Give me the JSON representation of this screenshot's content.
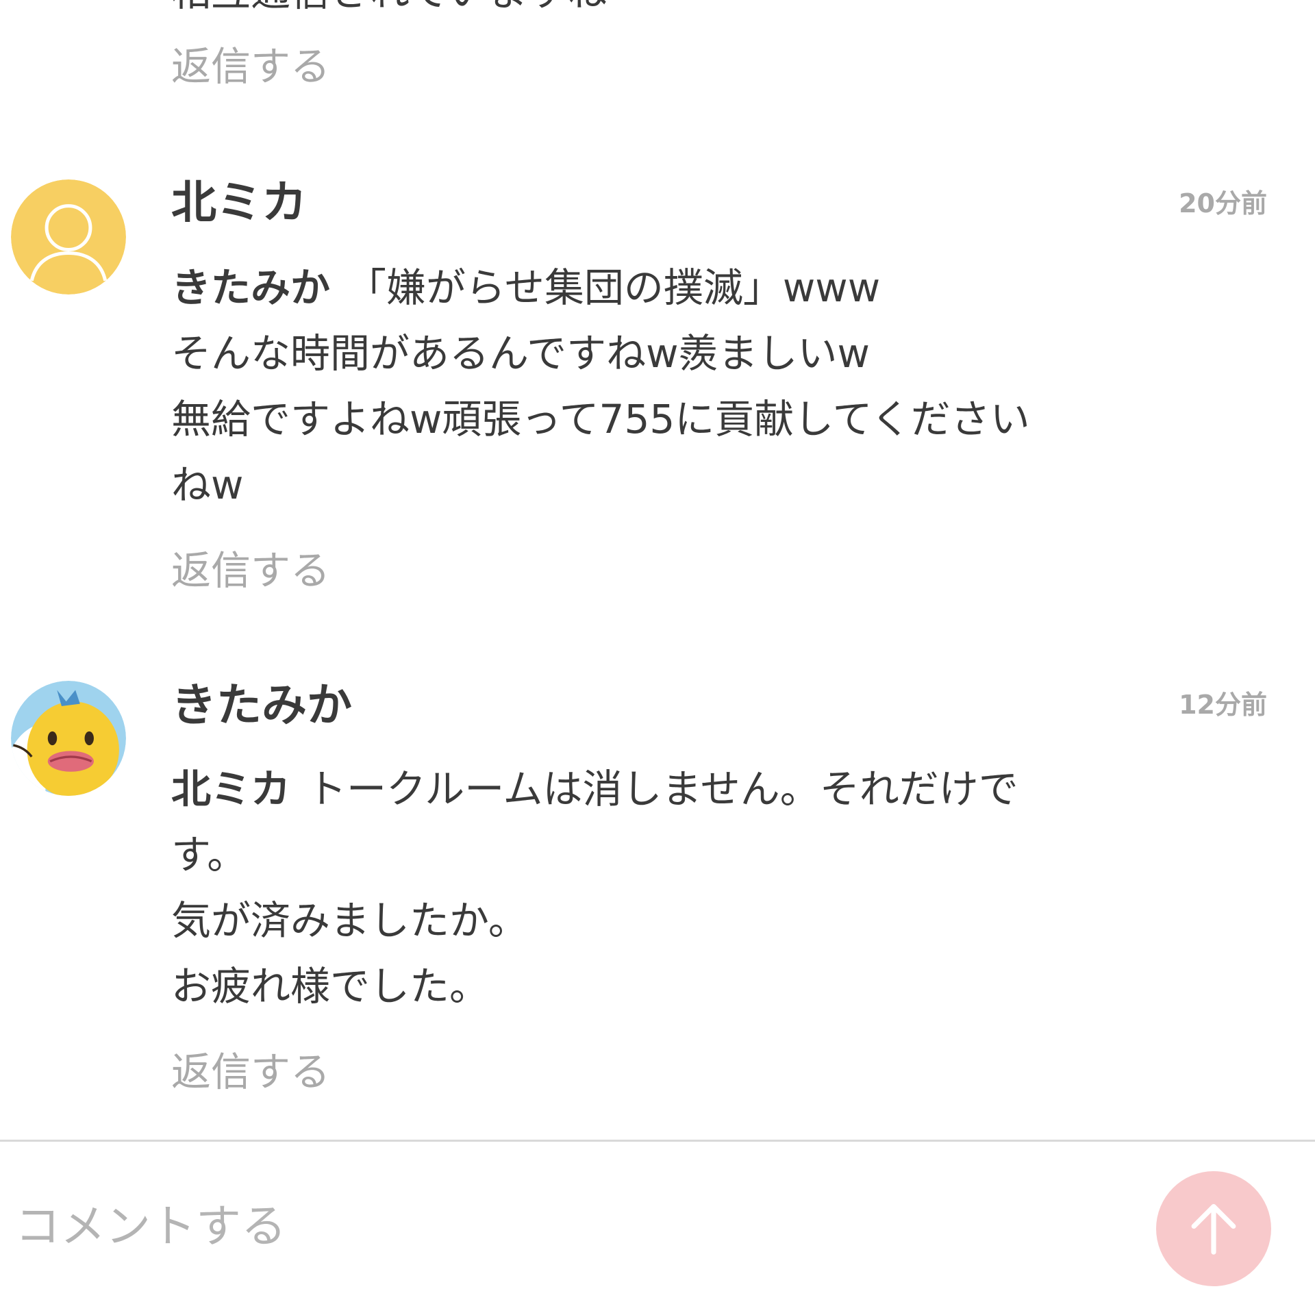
{
  "top_partial": {
    "line": "相互通信されていますね",
    "reply_label": "返信する"
  },
  "comments": [
    {
      "author": "北ミカ",
      "time": "20分前",
      "mention": "きたみか",
      "lines": [
        "「嫌がらせ集団の撲滅」www",
        "そんな時間があるんですねw羨ましいw",
        "無給ですよねw頑張って755に貢献してください",
        "ねw"
      ],
      "reply_label": "返信する",
      "avatar_icon": "default-user-icon",
      "avatar_color": "#f7cf62"
    },
    {
      "author": "きたみか",
      "time": "12分前",
      "mention": "北ミカ",
      "lines": [
        "トークルームは消しません。それだけで",
        "す。",
        "気が済みましたか。",
        "お疲れ様でした。"
      ],
      "reply_label": "返信する",
      "avatar_icon": "cartoon-character-icon"
    }
  ],
  "composer": {
    "placeholder": "コメントする",
    "send_icon": "arrow-up-icon",
    "send_color": "#f8c9cb"
  }
}
